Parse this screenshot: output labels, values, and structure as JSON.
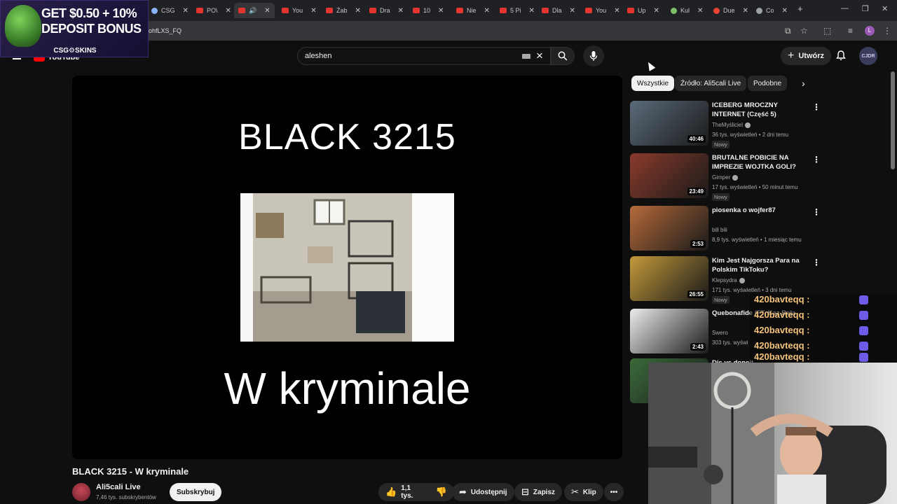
{
  "browser": {
    "tabs": [
      {
        "label": "CSG",
        "icon": "tab-favicon-icon"
      },
      {
        "label": "PO\\",
        "icon": "youtube-favicon-icon"
      },
      {
        "label": "",
        "icon": "youtube-favicon-icon",
        "active": true
      },
      {
        "label": "You",
        "icon": "youtube-favicon-icon"
      },
      {
        "label": "Żab",
        "icon": "youtube-favicon-icon"
      },
      {
        "label": "Dra",
        "icon": "youtube-favicon-icon"
      },
      {
        "label": "10",
        "icon": "youtube-favicon-icon"
      },
      {
        "label": "Nie",
        "icon": "youtube-favicon-icon"
      },
      {
        "label": "5 Pi",
        "icon": "youtube-favicon-icon"
      },
      {
        "label": "Dla",
        "icon": "youtube-favicon-icon"
      },
      {
        "label": "You",
        "icon": "youtube-favicon-icon"
      },
      {
        "label": "Up",
        "icon": "youtube-favicon-icon"
      },
      {
        "label": "Kul",
        "icon": "kuk-favicon-icon"
      },
      {
        "label": "Due",
        "icon": "maps-favicon-icon"
      },
      {
        "label": "Co",
        "icon": "site-favicon-icon"
      }
    ],
    "url_fragment": "ohfLXS_FQ"
  },
  "ad": {
    "line1": "GET $0.50 + 10%",
    "line2": "DEPOSIT BONUS",
    "brand": "CSG⚙SKINS"
  },
  "header": {
    "logo_text": "YouTube",
    "search_value": "aleshen",
    "create_label": "Utwórz",
    "avatar_text": "CJDR"
  },
  "player": {
    "top_text": "BLACK 3215",
    "bottom_text": "W kryminale"
  },
  "video": {
    "title": "BLACK 3215 - W kryminale",
    "channel": "Ali5cali Live",
    "subs": "7,46 tys. subskrybentów",
    "subscribe_label": "Subskrybuj",
    "likes": "1,1 tys.",
    "share_label": "Udostępnij",
    "save_label": "Zapisz",
    "clip_label": "Klip"
  },
  "chips": [
    "Wszystkie",
    "Źródło: Ali5cali Live",
    "Podobne"
  ],
  "recommendations": [
    {
      "title": "ICEBERG MROCZNY INTERNET (Część 5)",
      "channel": "TheMyśliciel",
      "verified": true,
      "meta": "36 tys. wyświetleń • 2 dni temu",
      "badge": "Nowy",
      "duration": "40:46",
      "color": "#5b6b7a"
    },
    {
      "title": "BRUTALNE POBICIE NA IMPREZIE WOJTKA GOLI?",
      "channel": "Gimper",
      "verified": true,
      "meta": "17 tys. wyświetleń • 50 minut temu",
      "badge": "Nowy",
      "duration": "23:49",
      "color": "#8a3b2b"
    },
    {
      "title": "piosenka o wojfer87",
      "channel": "bili bili",
      "verified": false,
      "meta": "8,9 tys. wyświetleń • 1 miesiąc temu",
      "badge": "",
      "duration": "2:53",
      "color": "#b56a3a"
    },
    {
      "title": "Kim Jest Najgorsza Para na Polskim TikToku?",
      "channel": "Klepsydra",
      "verified": true,
      "meta": "171 tys. wyświetleń • 3 dni temu",
      "badge": "Nowy",
      "duration": "26:55",
      "color": "#c49a3a"
    },
    {
      "title": "Quebonafide (FT. Kaz Bała",
      "channel": "Swero",
      "verified": false,
      "meta": "303 tys. wyświ",
      "badge": "",
      "duration": "2:43",
      "color": "#ececec"
    },
    {
      "title": "Dis vs donejt",
      "channel": "",
      "verified": false,
      "meta": "",
      "badge": "",
      "duration": "",
      "color": "#3a6b3a"
    }
  ],
  "chat": {
    "lines": [
      "420bavteqq :",
      "420bavteqq :",
      "420bavteqq :",
      "420bavteqq :",
      "420bavteqq :"
    ]
  },
  "colors": {
    "background": "#0f0f0f",
    "youtube_red": "#ff0000",
    "chat_name": "#f4c27b"
  }
}
